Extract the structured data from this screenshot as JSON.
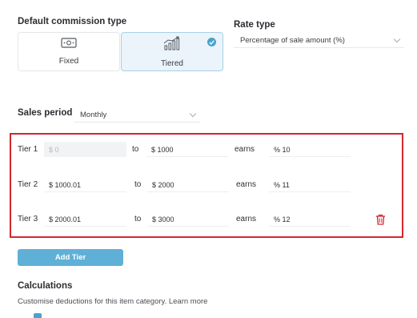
{
  "commission": {
    "heading": "Default commission type",
    "options": [
      {
        "label": "Fixed",
        "icon": "cash-icon",
        "selected": false
      },
      {
        "label": "Tiered",
        "icon": "growth-chart-icon",
        "selected": true
      }
    ]
  },
  "rate_type": {
    "heading": "Rate type",
    "value": "Percentage of sale amount (%)"
  },
  "sales_period": {
    "heading": "Sales period",
    "value": "Monthly"
  },
  "tiers": {
    "to_label": "to",
    "earns_label": "earns",
    "rows": [
      {
        "label": "Tier 1",
        "from": "$ 0",
        "to": "$ 1000",
        "rate": "% 10",
        "from_disabled": true,
        "deletable": false
      },
      {
        "label": "Tier 2",
        "from": "$ 1000.01",
        "to": "$ 2000",
        "rate": "% 11",
        "from_disabled": false,
        "deletable": false
      },
      {
        "label": "Tier 3",
        "from": "$ 2000.01",
        "to": "$ 3000",
        "rate": "% 12",
        "from_disabled": false,
        "deletable": true
      }
    ]
  },
  "add_tier_label": "Add Tier",
  "calculations": {
    "heading": "Calculations",
    "description": "Customise deductions for this item category. Learn more"
  },
  "colors": {
    "accent": "#5fb0d6",
    "selected_card_bg": "#eaf4fa",
    "highlight_border": "#d3262e",
    "delete_icon": "#d3262e"
  }
}
